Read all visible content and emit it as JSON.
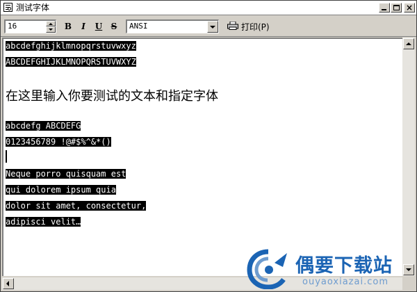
{
  "window": {
    "title": "测试字体"
  },
  "toolbar": {
    "font_size": "16",
    "bold_label": "B",
    "italic_label": "I",
    "underline_label": "U",
    "strike_label": "S",
    "charset": "ANSI",
    "print_label": "打印(P)"
  },
  "editor": {
    "lines": [
      "abcdefghijklmnopqrstuvwxyz",
      "ABCDEFGHIJKLMNOPQRSTUVWXYZ",
      "在这里输入你要测试的文本和指定字体",
      "abcdefg ABCDEFG",
      "0123456789 !@#$%^&*()",
      "Neque porro quisquam est",
      "qui dolorem ipsum quia",
      "dolor sit amet, consectetur,",
      "adipisci velit…"
    ]
  },
  "watermark": {
    "brand": "偶要下载站",
    "url": "ouyaoxiazai.com",
    "colors": {
      "primary": "#1b64b4",
      "secondary": "#6e9ccf"
    }
  }
}
